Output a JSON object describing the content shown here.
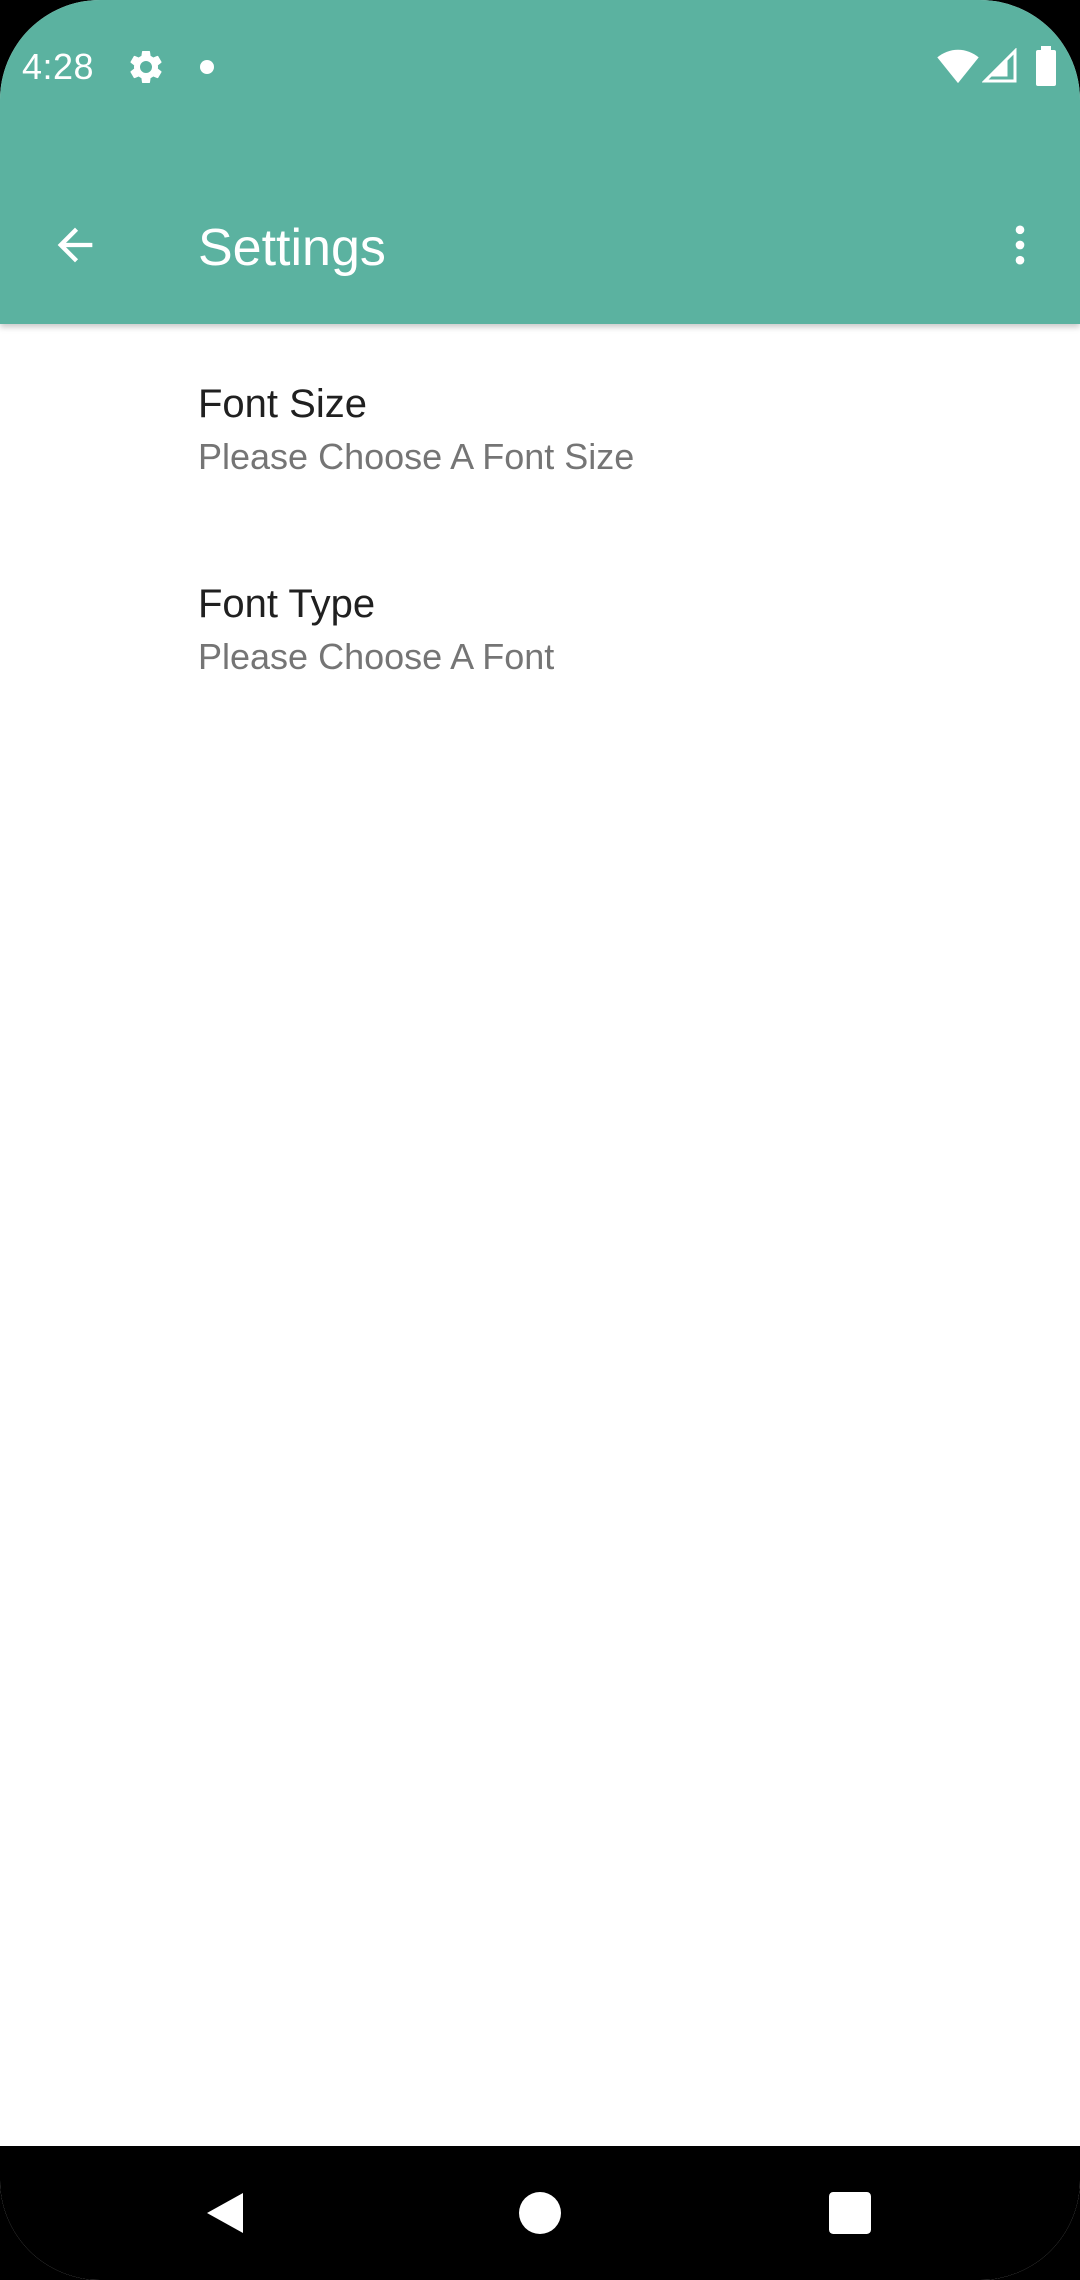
{
  "status_bar": {
    "time": "4:28",
    "icons": [
      "gear-icon",
      "notification-dot-icon",
      "wifi-icon",
      "signal-icon",
      "battery-icon"
    ]
  },
  "app_bar": {
    "title": "Settings",
    "navigation_icon": "arrow-back-icon",
    "overflow_icon": "more-vert-icon",
    "color": "#5bb2a0"
  },
  "preferences": [
    {
      "title": "Font Size",
      "summary": "Please Choose A Font Size"
    },
    {
      "title": "Font Type",
      "summary": "Please Choose A Font"
    }
  ],
  "nav_bar": {
    "buttons": [
      "back-triangle-icon",
      "home-circle-icon",
      "recents-square-icon"
    ]
  }
}
